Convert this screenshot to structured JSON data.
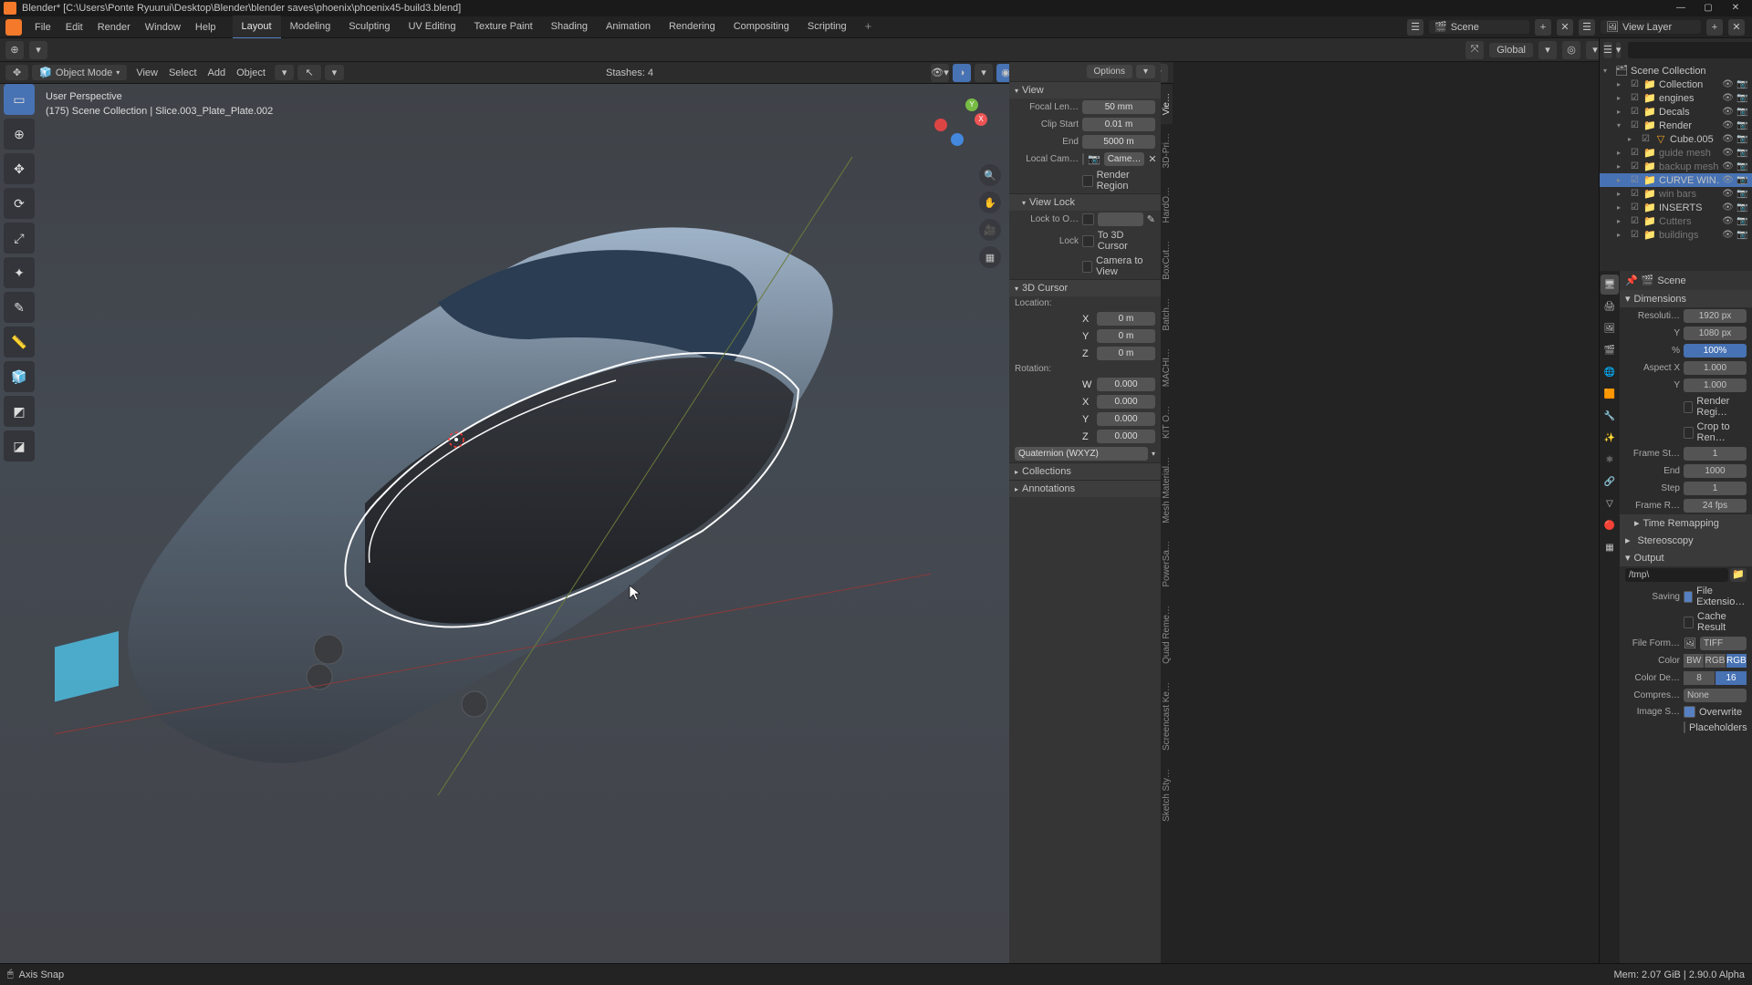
{
  "titlebar": {
    "text": "Blender* [C:\\Users\\Ponte Ryuurui\\Desktop\\Blender\\blender saves\\phoenix\\phoenix45-build3.blend]",
    "min": "—",
    "max": "▢",
    "close": "✕"
  },
  "menu": {
    "items": [
      "File",
      "Edit",
      "Render",
      "Window",
      "Help"
    ],
    "tabs": [
      "Layout",
      "Modeling",
      "Sculpting",
      "UV Editing",
      "Texture Paint",
      "Shading",
      "Animation",
      "Rendering",
      "Compositing",
      "Scripting"
    ],
    "add": "+",
    "scene_label": "Scene",
    "viewlayer_label": "View Layer"
  },
  "toolrow": {
    "orientation": "Global"
  },
  "viewhead": {
    "mode": "Object Mode",
    "menus": [
      "View",
      "Select",
      "Add",
      "Object"
    ],
    "stash": "Stashes:   4"
  },
  "viewport": {
    "persp": "User Perspective",
    "collection": "(175) Scene Collection | Slice.003_Plate_Plate.002"
  },
  "vtabs": [
    "Vie…",
    "3D-Pri…",
    "HardO…",
    "BoxCut…",
    "Batch…",
    "MACHI…",
    "KIT O…",
    "Mesh Material…",
    "PowerSa…",
    "Quad Reme…",
    "Screencast Ke…",
    "Sketch Sty…"
  ],
  "npanel": {
    "options": "Options",
    "view": "View",
    "focal_lbl": "Focal Len…",
    "focal": "50 mm",
    "clipstart_lbl": "Clip Start",
    "clipstart": "0.01 m",
    "clipend_lbl": "End",
    "clipend": "5000 m",
    "localcam_lbl": "Local Cam…",
    "localcam": "Came…",
    "render_region": "Render Region",
    "viewlock": "View Lock",
    "locktoobj_lbl": "Lock to O…",
    "lock_lbl": "Lock",
    "lock_3d": "To 3D Cursor",
    "lock_cam": "Camera to View",
    "cursor": "3D Cursor",
    "location": "Location:",
    "rotation": "Rotation:",
    "loc_x": "0 m",
    "loc_y": "0 m",
    "loc_z": "0 m",
    "rot_w": "0.000",
    "rot_x": "0.000",
    "rot_y": "0.000",
    "rot_z": "0.000",
    "rot_mode": "Quaternion (WXYZ)",
    "collections": "Collections",
    "annotations": "Annotations"
  },
  "outliner": {
    "root": "Scene Collection",
    "items": [
      {
        "name": "Collection",
        "ind": 1,
        "tri": "▸",
        "icon": "📁",
        "color": "#e8e8e8"
      },
      {
        "name": "engines",
        "ind": 1,
        "tri": "▸",
        "icon": "📁",
        "color": "#e8e8e8"
      },
      {
        "name": "Decals",
        "ind": 1,
        "tri": "▸",
        "icon": "📁",
        "color": "#e8e8e8"
      },
      {
        "name": "Render",
        "ind": 1,
        "tri": "▾",
        "icon": "📁",
        "color": "#e8e8e8"
      },
      {
        "name": "Cube.005",
        "ind": 2,
        "tri": "▸",
        "icon": "▽",
        "color": "#f5a623"
      },
      {
        "name": "guide mesh",
        "ind": 1,
        "tri": "▸",
        "icon": "📁",
        "color": "#888",
        "dim": true
      },
      {
        "name": "backup mesh",
        "ind": 1,
        "tri": "▸",
        "icon": "📁",
        "color": "#888",
        "dim": true
      },
      {
        "name": "CURVE WIN…",
        "ind": 1,
        "tri": "▸",
        "icon": "📁",
        "color": "#fff",
        "sel": true
      },
      {
        "name": "win bars",
        "ind": 1,
        "tri": "▸",
        "icon": "📁",
        "color": "#888",
        "dim": true
      },
      {
        "name": "INSERTS",
        "ind": 1,
        "tri": "▸",
        "icon": "📁",
        "color": "#e8e8e8"
      },
      {
        "name": "Cutters",
        "ind": 1,
        "tri": "▸",
        "icon": "📁",
        "color": "#c9b171",
        "dim": true
      },
      {
        "name": "buildings",
        "ind": 1,
        "tri": "▸",
        "icon": "📁",
        "color": "#888",
        "dim": true
      }
    ]
  },
  "props": {
    "crumb_scene": "Scene",
    "dim": "Dimensions",
    "resx_lbl": "Resoluti…",
    "resx": "1920 px",
    "resy_lbl": "Y",
    "resy": "1080 px",
    "pct_lbl": "%",
    "pct": "100%",
    "aspx_lbl": "Aspect X",
    "aspx": "1.000",
    "aspy_lbl": "Y",
    "aspy": "1.000",
    "render_region": "Render Regi…",
    "crop": "Crop to Ren…",
    "fstart_lbl": "Frame St…",
    "fstart": "1",
    "fend_lbl": "End",
    "fend": "1000",
    "fstep_lbl": "Step",
    "fstep": "1",
    "frate_lbl": "Frame R…",
    "frate": "24 fps",
    "remap": "Time Remapping",
    "stereo": "Stereoscopy",
    "output": "Output",
    "path": "/tmp\\",
    "saving_lbl": "Saving",
    "file_ext": "File Extensio…",
    "cache": "Cache Result",
    "fform_lbl": "File Form…",
    "fform": "TIFF",
    "color_lbl": "Color",
    "color_opts": [
      "BW",
      "RGB",
      "RGB"
    ],
    "cdepth_lbl": "Color De…",
    "cdepth_opts": [
      "8",
      "16"
    ],
    "compress_lbl": "Compres…",
    "compress": "None",
    "imgseq_lbl": "Image S…",
    "overwrite": "Overwrite",
    "placeholders": "Placeholders"
  },
  "status": {
    "mode": "Axis Snap",
    "mem": "Mem: 2.07 GiB | 2.90.0 Alpha"
  },
  "axes": {
    "x": "X",
    "y": "Y",
    "z": "Z"
  }
}
